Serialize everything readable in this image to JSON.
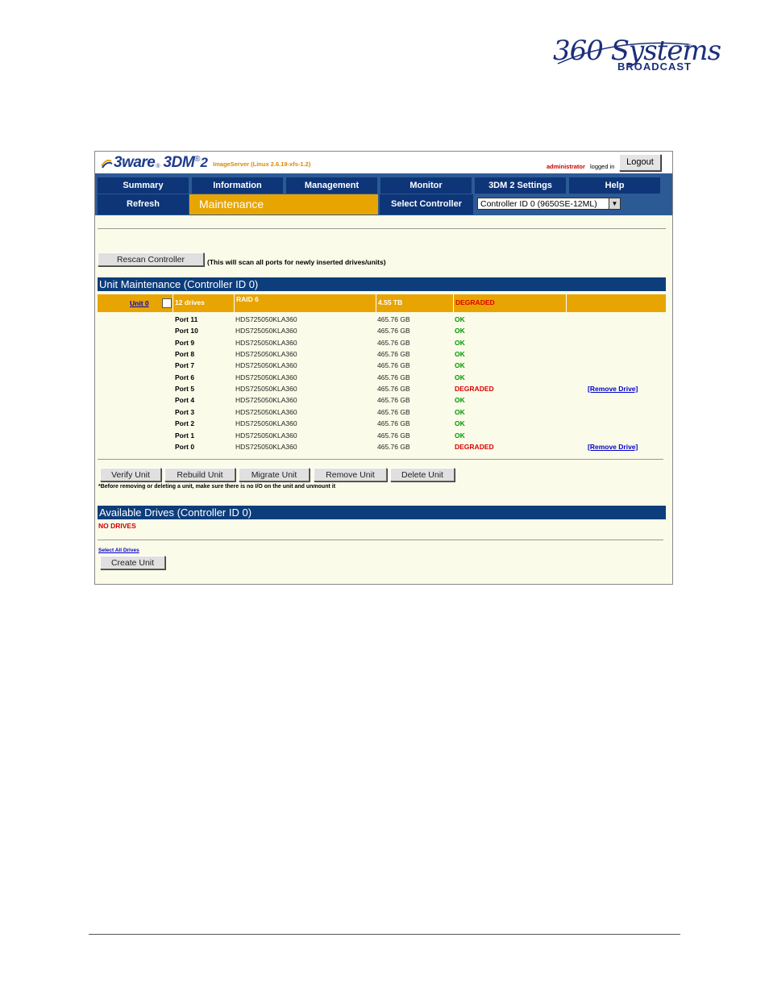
{
  "doc_logo": {
    "script": "360 Systems",
    "sub": "BROADCAST",
    "reg": "®"
  },
  "app": {
    "brand_name": "3ware",
    "brand_reg": "®",
    "product": "3DM",
    "product_sup": "®",
    "product_num": "2",
    "version": "ImageServer (Linux 2.6.19-xfs-1.2)",
    "user": "administrator",
    "logged_in": "logged in",
    "logout_label": "Logout"
  },
  "nav": {
    "items": [
      "Summary",
      "Information",
      "Management",
      "Monitor",
      "3DM 2 Settings",
      "Help"
    ],
    "refresh": "Refresh",
    "current_page": "Maintenance",
    "select_controller_label": "Select Controller",
    "controller_value": "Controller ID 0 (9650SE-12ML)"
  },
  "rescan": {
    "button": "Rescan Controller",
    "note": "(This will scan all ports for newly inserted drives/units)"
  },
  "unit_maintenance": {
    "title": "Unit Maintenance (Controller ID 0)",
    "unit": {
      "link": "Unit 0",
      "drives": "12 drives",
      "raid": "RAID 6",
      "size": "4.55 TB",
      "status": "DEGRADED"
    },
    "ports": [
      {
        "name": "Port 11",
        "model": "HDS725050KLA360",
        "capacity": "465.76 GB",
        "status": "OK",
        "action": ""
      },
      {
        "name": "Port 10",
        "model": "HDS725050KLA360",
        "capacity": "465.76 GB",
        "status": "OK",
        "action": ""
      },
      {
        "name": "Port 9",
        "model": "HDS725050KLA360",
        "capacity": "465.76 GB",
        "status": "OK",
        "action": ""
      },
      {
        "name": "Port 8",
        "model": "HDS725050KLA360",
        "capacity": "465.76 GB",
        "status": "OK",
        "action": ""
      },
      {
        "name": "Port 7",
        "model": "HDS725050KLA360",
        "capacity": "465.76 GB",
        "status": "OK",
        "action": ""
      },
      {
        "name": "Port 6",
        "model": "HDS725050KLA360",
        "capacity": "465.76 GB",
        "status": "OK",
        "action": ""
      },
      {
        "name": "Port 5",
        "model": "HDS725050KLA360",
        "capacity": "465.76 GB",
        "status": "DEGRADED",
        "action": "[Remove Drive]"
      },
      {
        "name": "Port 4",
        "model": "HDS725050KLA360",
        "capacity": "465.76 GB",
        "status": "OK",
        "action": ""
      },
      {
        "name": "Port 3",
        "model": "HDS725050KLA360",
        "capacity": "465.76 GB",
        "status": "OK",
        "action": ""
      },
      {
        "name": "Port 2",
        "model": "HDS725050KLA360",
        "capacity": "465.76 GB",
        "status": "OK",
        "action": ""
      },
      {
        "name": "Port 1",
        "model": "HDS725050KLA360",
        "capacity": "465.76 GB",
        "status": "OK",
        "action": ""
      },
      {
        "name": "Port 0",
        "model": "HDS725050KLA360",
        "capacity": "465.76 GB",
        "status": "DEGRADED",
        "action": "[Remove Drive]"
      }
    ],
    "buttons": [
      "Verify Unit",
      "Rebuild Unit",
      "Migrate Unit",
      "Remove Unit",
      "Delete Unit"
    ],
    "warning": "*Before removing or deleting a unit, make sure there is no I/O on the unit and unmount it"
  },
  "available_drives": {
    "title": "Available Drives (Controller ID 0)",
    "empty": "NO DRIVES",
    "select_all": "Select All Drives",
    "create_button": "Create Unit"
  },
  "colors": {
    "nav_dark": "#0d3577",
    "nav_bg": "#2c5a95",
    "accent": "#e8a502",
    "ok": "#009900",
    "degraded": "#dd0000",
    "panel": "#fbfbe9"
  }
}
